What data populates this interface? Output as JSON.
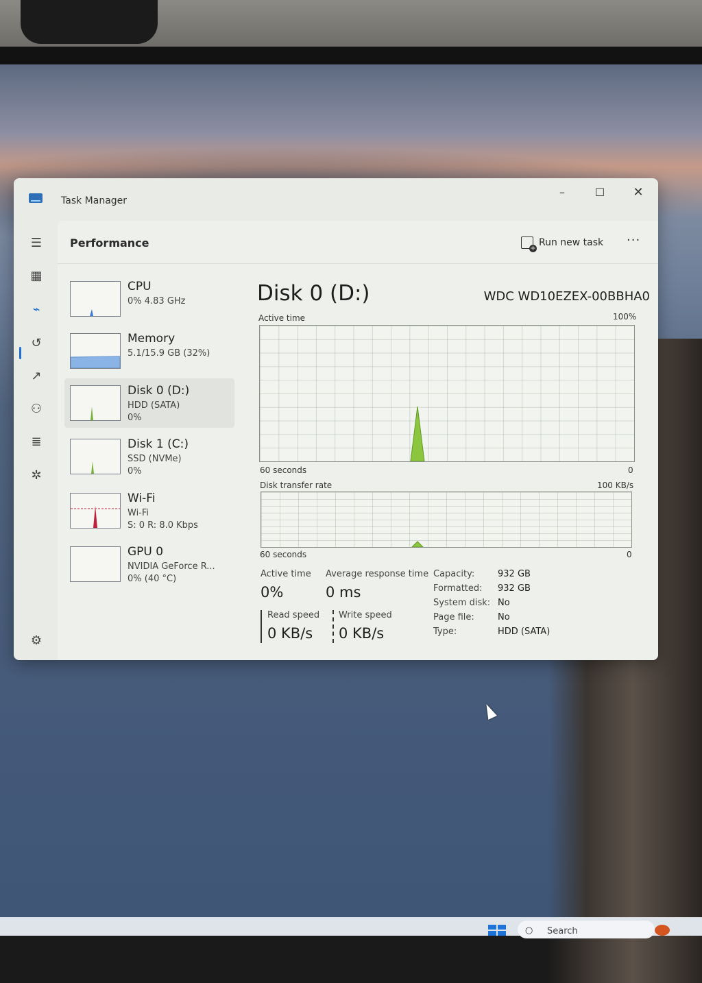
{
  "window": {
    "title": "Task Manager",
    "minimize": "–",
    "maximize": "☐",
    "close": "✕"
  },
  "nav": [
    {
      "name": "hamburger-menu-icon",
      "glyph": "☰"
    },
    {
      "name": "processes-icon",
      "glyph": "▦"
    },
    {
      "name": "performance-icon",
      "glyph": "⌁"
    },
    {
      "name": "app-history-icon",
      "glyph": "↺"
    },
    {
      "name": "startup-apps-icon",
      "glyph": "↗"
    },
    {
      "name": "users-icon",
      "glyph": "⚇"
    },
    {
      "name": "details-icon",
      "glyph": "≣"
    },
    {
      "name": "services-icon",
      "glyph": "✲"
    },
    {
      "name": "settings-icon",
      "glyph": "⚙"
    }
  ],
  "header": {
    "title": "Performance",
    "run_new_task": "Run new task",
    "more": "···"
  },
  "devices": [
    {
      "name": "CPU",
      "line1": "0%  4.83 GHz",
      "line2": "",
      "line3": ""
    },
    {
      "name": "Memory",
      "line1": "5.1/15.9 GB (32%)",
      "line2": "",
      "line3": ""
    },
    {
      "name": "Disk 0 (D:)",
      "line1": "HDD (SATA)",
      "line2": "0%",
      "line3": ""
    },
    {
      "name": "Disk 1 (C:)",
      "line1": "SSD (NVMe)",
      "line2": "0%",
      "line3": ""
    },
    {
      "name": "Wi-Fi",
      "line1": "Wi-Fi",
      "line2": "S: 0 R: 8.0 Kbps",
      "line3": ""
    },
    {
      "name": "GPU 0",
      "line1": "NVIDIA GeForce R...",
      "line2": "0%  (40 °C)",
      "line3": ""
    }
  ],
  "panel": {
    "title": "Disk 0 (D:)",
    "model": "WDC WD10EZEX-00BBHA0",
    "graph1_label": "Active time",
    "graph1_max": "100%",
    "graph1_time": "60 seconds",
    "graph1_min": "0",
    "graph2_label": "Disk transfer rate",
    "graph2_max": "100 KB/s",
    "graph2_time": "60 seconds",
    "graph2_min": "0"
  },
  "stats": {
    "active_time_label": "Active time",
    "active_time_value": "0%",
    "avg_resp_label": "Average response time",
    "avg_resp_value": "0 ms",
    "read_label": "Read speed",
    "read_value": "0 KB/s",
    "write_label": "Write speed",
    "write_value": "0 KB/s"
  },
  "properties": [
    {
      "key": "Capacity:",
      "value": "932 GB"
    },
    {
      "key": "Formatted:",
      "value": "932 GB"
    },
    {
      "key": "System disk:",
      "value": "No"
    },
    {
      "key": "Page file:",
      "value": "No"
    },
    {
      "key": "Type:",
      "value": "HDD (SATA)"
    }
  ],
  "taskbar": {
    "search_placeholder": "Search"
  },
  "colors": {
    "accent": "#1f6ed4",
    "disk_graph": "#8cc63f",
    "wifi_graph": "#c0203a",
    "memory_graph": "#5b8fd0"
  }
}
